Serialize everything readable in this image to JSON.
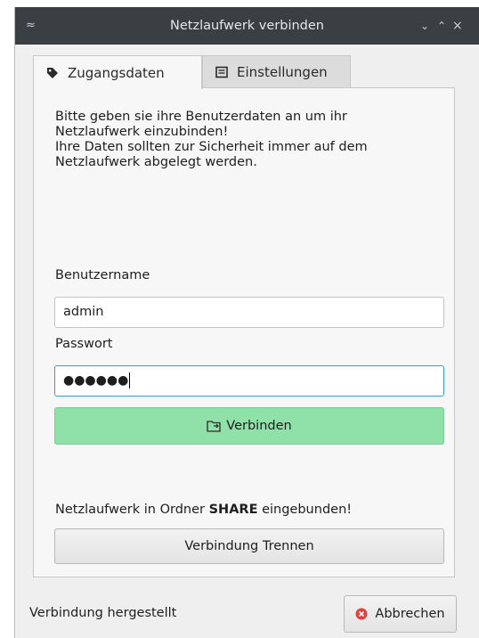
{
  "window": {
    "title": "Netzlaufwerk verbinden",
    "left_glyph": "≈",
    "buttons": [
      "⌄",
      "⌃",
      "×"
    ]
  },
  "tabs": [
    {
      "label": "Zugangsdaten",
      "icon": "tag-icon",
      "active": true
    },
    {
      "label": "Einstellungen",
      "icon": "settings-list-icon",
      "active": false
    }
  ],
  "intro_text": [
    "Bitte geben sie ihre Benutzerdaten an um ihr",
    "Netzlaufwerk einzubinden!",
    "Ihre Daten sollten zur Sicherheit immer auf dem",
    "Netzlaufwerk abgelegt werden."
  ],
  "form": {
    "username_label": "Benutzername",
    "username_value": "admin",
    "password_label": "Passwort",
    "password_value": "●●●●●●"
  },
  "connect_button": {
    "label": "Verbinden",
    "icon": "folder-connect-icon",
    "color": "#8fe0a9"
  },
  "share_status": {
    "prefix": "Netzlaufwerk in Ordner ",
    "folder": "SHARE",
    "suffix": " eingebunden!"
  },
  "disconnect_button": {
    "label": "Verbindung Trennen"
  },
  "footer": {
    "status": "Verbindung hergestellt",
    "cancel_label": "Abbrechen",
    "cancel_icon": "cancel-icon",
    "cancel_icon_color": "#e0413b"
  },
  "colors": {
    "titlebar": "#3a3f44",
    "accent_focus": "#3a9ad9"
  }
}
